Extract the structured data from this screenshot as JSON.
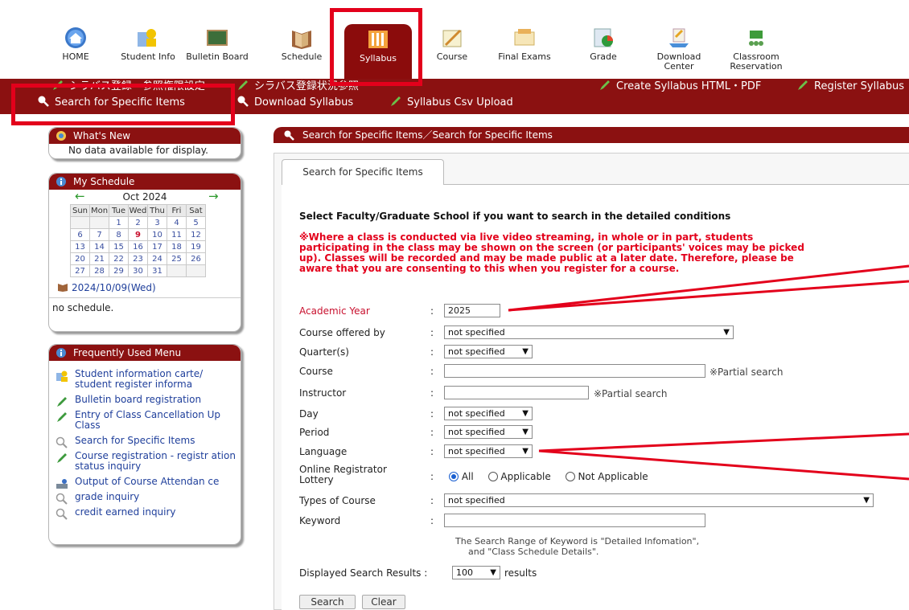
{
  "topnav": [
    {
      "label": "HOME",
      "icon": "home-icon"
    },
    {
      "label": "Student Info",
      "icon": "student-icon"
    },
    {
      "label": "Bulletin Board",
      "icon": "bulletin-board-icon"
    },
    {
      "label": "Schedule",
      "icon": "schedule-book-icon"
    },
    {
      "label": "Syllabus",
      "icon": "syllabus-icon"
    },
    {
      "label": "Course",
      "icon": "course-icon"
    },
    {
      "label": "Final Exams",
      "icon": "final-exams-icon"
    },
    {
      "label": "Grade",
      "icon": "grade-icon"
    },
    {
      "label": "Download Center",
      "icon": "download-icon"
    },
    {
      "label": "Classroom Reservation",
      "icon": "classroom-icon"
    }
  ],
  "submenu": {
    "row1": [
      "シラバス登録・参照権限設定",
      "シラバス登録状況参照",
      "Create Syllabus HTML・PDF",
      "Register Syllabus"
    ],
    "row2": [
      "Search for Specific Items",
      "Download Syllabus",
      "Syllabus Csv Upload"
    ]
  },
  "whats_new": {
    "title": "What's New",
    "body": "No data available for display."
  },
  "schedule": {
    "title": "My Schedule",
    "month": "Oct 2024",
    "weekdays": [
      "Sun",
      "Mon",
      "Tue",
      "Wed",
      "Thu",
      "Fri",
      "Sat"
    ],
    "weeks": [
      [
        "",
        "",
        "1",
        "2",
        "3",
        "4",
        "5"
      ],
      [
        "6",
        "7",
        "8",
        "9",
        "10",
        "11",
        "12"
      ],
      [
        "13",
        "14",
        "15",
        "16",
        "17",
        "18",
        "19"
      ],
      [
        "20",
        "21",
        "22",
        "23",
        "24",
        "25",
        "26"
      ],
      [
        "27",
        "28",
        "29",
        "30",
        "31",
        "",
        ""
      ]
    ],
    "today": "9",
    "date": "2024/10/09(Wed)",
    "note": "no schedule."
  },
  "freq_menu": {
    "title": "Frequently Used Menu",
    "items": [
      {
        "label": "Student information carte/ student register informa",
        "icon": "student-icon"
      },
      {
        "label": "Bulletin board registration",
        "icon": "pencil-icon"
      },
      {
        "label": "Entry of Class Cancellation Up Class",
        "icon": "pencil-icon"
      },
      {
        "label": "Search for Specific Items",
        "icon": "magnifier-icon"
      },
      {
        "label": "Course registration - registr ation status inquiry",
        "icon": "pencil-icon"
      },
      {
        "label": "Output of Course Attendan ce",
        "icon": "attendance-icon"
      },
      {
        "label": "grade inquiry",
        "icon": "magnifier-icon"
      },
      {
        "label": "credit earned inquiry",
        "icon": "magnifier-icon"
      }
    ]
  },
  "main": {
    "header": "Search for Specific Items／Search for Specific Items",
    "tab": "Search for Specific Items",
    "instruction": "Select Faculty/Graduate School if you want to search in the detailed conditions",
    "warning": "※Where a class is conducted via live video streaming, in whole or in part, students participating in the class may be shown on the screen (or participants' voices may be picked up). Classes will be recorded and may be made public at a later date. Therefore, please be aware that you are consenting to this when you register for a course.",
    "colon": ":",
    "fields": {
      "academic_year": {
        "label": "Academic Year",
        "value": "2025"
      },
      "course_offered": {
        "label": "Course offered by",
        "value": "not specified"
      },
      "quarter": {
        "label": "Quarter(s)",
        "value": "not specified"
      },
      "course": {
        "label": "Course",
        "value": "",
        "note": "※Partial search"
      },
      "instructor": {
        "label": "Instructor",
        "value": "",
        "note": "※Partial search"
      },
      "day": {
        "label": "Day",
        "value": "not specified"
      },
      "period": {
        "label": "Period",
        "value": "not specified"
      },
      "language": {
        "label": "Language",
        "value": "not specified"
      },
      "lottery": {
        "label": "Online Registrator Lottery",
        "options": [
          "All",
          "Applicable",
          "Not Applicable"
        ],
        "selected": "All"
      },
      "types": {
        "label": "Types of Course",
        "value": "not specified"
      },
      "keyword": {
        "label": "Keyword",
        "value": "",
        "note1": "The Search Range of Keyword is \"Detailed Infomation\",",
        "note2": "and \"Class Schedule Details\"."
      }
    },
    "results": {
      "label": "Displayed Search Results :",
      "value": "100",
      "suffix": "results"
    },
    "buttons": {
      "search": "Search",
      "clear": "Clear"
    }
  },
  "colors": {
    "brand": "#8b1111",
    "highlight": "#e3001b",
    "link": "#1f3f9b",
    "warning": "#e3001b"
  }
}
